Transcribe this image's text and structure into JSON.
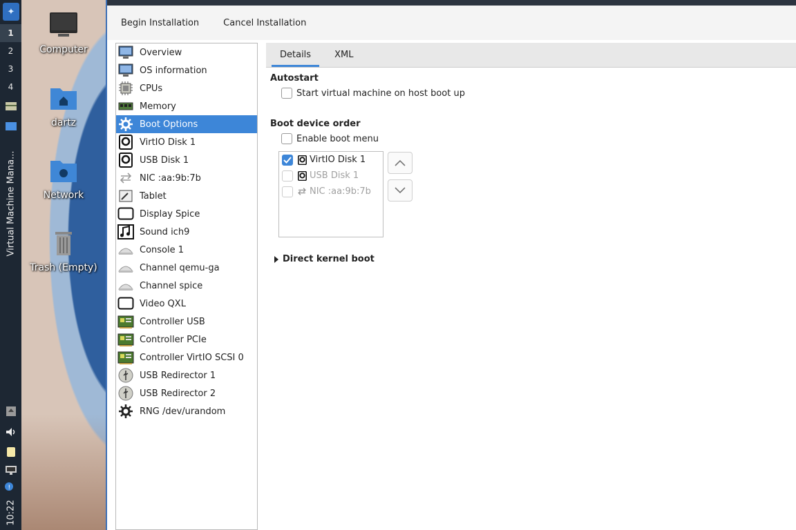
{
  "taskbar": {
    "workspaces": [
      "1",
      "2",
      "3",
      "4"
    ],
    "task_label": "Virtual Machine Mana...",
    "clock": "10:22"
  },
  "desktop": {
    "icons": [
      {
        "label": "Computer",
        "icon": "monitor-icon"
      },
      {
        "label": "dartz",
        "icon": "home-folder-icon"
      },
      {
        "label": "Network",
        "icon": "network-folder-icon"
      },
      {
        "label": "Trash (Empty)",
        "icon": "trash-icon"
      }
    ]
  },
  "toolbar": {
    "begin_label": "Begin Installation",
    "cancel_label": "Cancel Installation"
  },
  "sidebar": {
    "items": [
      {
        "label": "Overview",
        "icon": "monitor-icon"
      },
      {
        "label": "OS information",
        "icon": "monitor-icon"
      },
      {
        "label": "CPUs",
        "icon": "cpu-chip-icon"
      },
      {
        "label": "Memory",
        "icon": "memory-module-icon"
      },
      {
        "label": "Boot Options",
        "icon": "gear-icon",
        "selected": true
      },
      {
        "label": "VirtIO Disk 1",
        "icon": "disk-icon"
      },
      {
        "label": "USB Disk 1",
        "icon": "disk-icon"
      },
      {
        "label": "NIC :aa:9b:7b",
        "icon": "network-arrows-icon"
      },
      {
        "label": "Tablet",
        "icon": "tablet-icon"
      },
      {
        "label": "Display Spice",
        "icon": "display-icon"
      },
      {
        "label": "Sound ich9",
        "icon": "sound-icon"
      },
      {
        "label": "Console 1",
        "icon": "serial-console-icon"
      },
      {
        "label": "Channel qemu-ga",
        "icon": "serial-console-icon"
      },
      {
        "label": "Channel spice",
        "icon": "serial-console-icon"
      },
      {
        "label": "Video QXL",
        "icon": "display-icon"
      },
      {
        "label": "Controller USB",
        "icon": "controller-card-icon"
      },
      {
        "label": "Controller PCIe",
        "icon": "controller-card-icon"
      },
      {
        "label": "Controller VirtIO SCSI 0",
        "icon": "controller-card-icon"
      },
      {
        "label": "USB Redirector 1",
        "icon": "usb-icon"
      },
      {
        "label": "USB Redirector 2",
        "icon": "usb-icon"
      },
      {
        "label": "RNG /dev/urandom",
        "icon": "gear-icon"
      }
    ]
  },
  "tabs": [
    {
      "label": "Details",
      "active": true
    },
    {
      "label": "XML",
      "active": false
    }
  ],
  "boot_options": {
    "autostart_title": "Autostart",
    "autostart_checkbox_label": "Start virtual machine on host boot up",
    "autostart_checked": false,
    "boot_order_title": "Boot device order",
    "boot_menu_label": "Enable boot menu",
    "boot_menu_checked": false,
    "boot_devices": [
      {
        "label": "VirtIO Disk 1",
        "checked": true,
        "enabled": true,
        "icon": "disk-icon"
      },
      {
        "label": "USB Disk 1",
        "checked": false,
        "enabled": false,
        "icon": "disk-icon"
      },
      {
        "label": "NIC :aa:9b:7b",
        "checked": false,
        "enabled": false,
        "icon": "network-arrows-icon"
      }
    ],
    "move_up_icon": "chevron-up-icon",
    "move_down_icon": "chevron-down-icon",
    "direct_kernel_label": "Direct kernel boot"
  },
  "colors": {
    "accent": "#3d86d8",
    "taskbar_bg": "#1d2733"
  }
}
